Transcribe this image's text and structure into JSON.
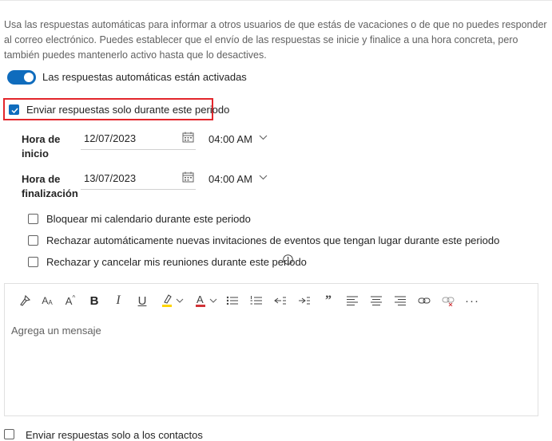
{
  "intro_text": "Usa las respuestas automáticas para informar a otros usuarios de que estás de vacaciones o de que no puedes responder al correo electrónico. Puedes establecer que el envío de las respuestas se inicie y finalice a una hora concreta, pero también puedes mantenerlo activo hasta que lo desactives.",
  "toggle": {
    "label": "Las respuestas automáticas están activadas",
    "on": true
  },
  "period_checkbox": {
    "label": "Enviar respuestas solo durante este periodo",
    "checked": true
  },
  "start": {
    "label_line1": "Hora de",
    "label_line2": "inicio",
    "date": "12/07/2023",
    "time": "04:00 AM"
  },
  "end": {
    "label_line1": "Hora de",
    "label_line2": "finalización",
    "date": "13/07/2023",
    "time": "04:00 AM"
  },
  "options": [
    {
      "label": "Bloquear mi calendario durante este periodo",
      "checked": false
    },
    {
      "label": "Rechazar automáticamente nuevas invitaciones de eventos que tengan lugar durante este periodo",
      "checked": false
    },
    {
      "label": "Rechazar y cancelar mis reuniones durante este periodo",
      "checked": false
    }
  ],
  "editor": {
    "placeholder": "Agrega un mensaje"
  },
  "bottom_option": {
    "label": "Enviar respuestas solo a los contactos",
    "checked": false
  },
  "colors": {
    "accent": "#0f6cbd",
    "highlight_border": "#e3262b",
    "highlighter_yellow": "#ffd500",
    "font_color_red": "#d13438"
  }
}
